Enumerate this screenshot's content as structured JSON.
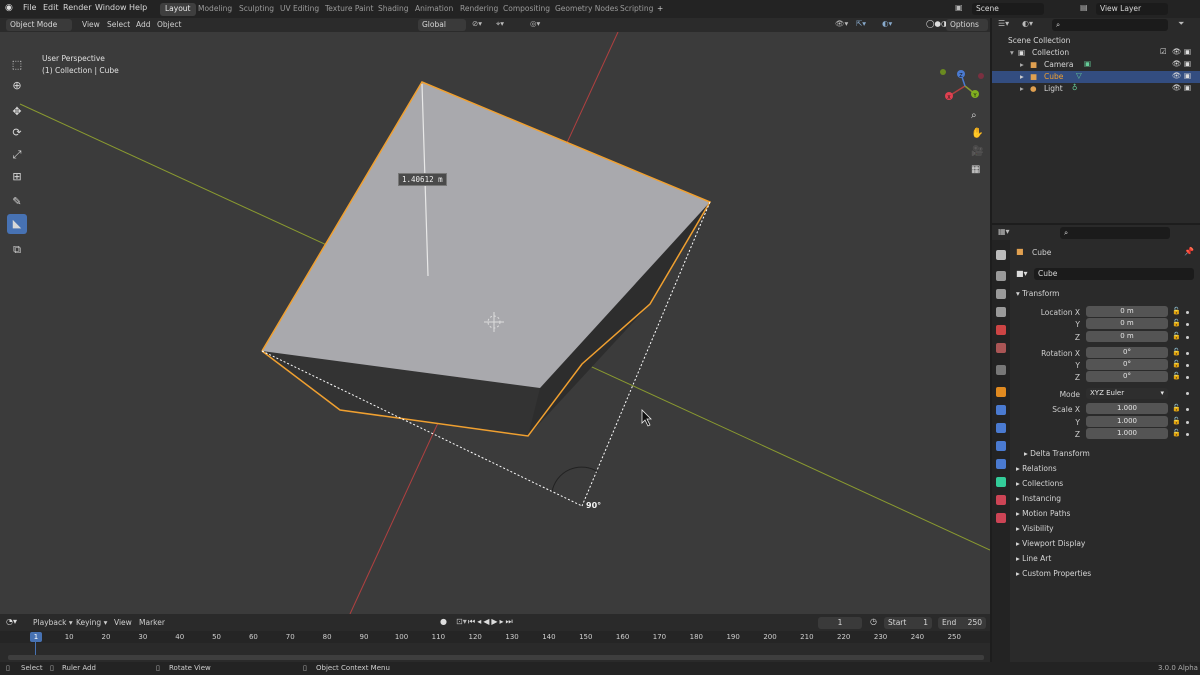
{
  "topbar": {
    "menus": [
      "File",
      "Edit",
      "Render",
      "Window",
      "Help"
    ],
    "workspaces": [
      "Layout",
      "Modeling",
      "Sculpting",
      "UV Editing",
      "Texture Paint",
      "Shading",
      "Animation",
      "Rendering",
      "Compositing",
      "Geometry Nodes",
      "Scripting"
    ],
    "active_workspace": "Layout",
    "add_tab": "+",
    "scene": "Scene",
    "view_layer": "View Layer"
  },
  "viewport_header": {
    "mode": "Object Mode",
    "menus": [
      "View",
      "Select",
      "Add",
      "Object"
    ],
    "orientation": "Global",
    "options": "Options"
  },
  "viewport": {
    "perspective": "User Perspective",
    "collection_info": "(1) Collection | Cube",
    "measure_length": "1.40612 m",
    "measure_angle": "90°",
    "gizmo_axes": [
      "X",
      "Y",
      "Z"
    ]
  },
  "outliner": {
    "root": "Scene Collection",
    "collection": "Collection",
    "items": [
      "Camera",
      "Cube",
      "Light"
    ]
  },
  "properties": {
    "object_name": "Cube",
    "data_name": "Cube",
    "transform_title": "Transform",
    "location": {
      "label_x": "Location X",
      "label_y": "Y",
      "label_z": "Z",
      "x": "0 m",
      "y": "0 m",
      "z": "0 m"
    },
    "rotation": {
      "label_x": "Rotation X",
      "label_y": "Y",
      "label_z": "Z",
      "x": "0°",
      "y": "0°",
      "z": "0°"
    },
    "mode_label": "Mode",
    "mode_value": "XYZ Euler",
    "scale": {
      "label_x": "Scale X",
      "label_y": "Y",
      "label_z": "Z",
      "x": "1.000",
      "y": "1.000",
      "z": "1.000"
    },
    "delta_transform": "Delta Transform",
    "panels": [
      "Relations",
      "Collections",
      "Instancing",
      "Motion Paths",
      "Visibility",
      "Viewport Display",
      "Line Art",
      "Custom Properties"
    ]
  },
  "timeline": {
    "menus": [
      "Playback",
      "Keying",
      "View",
      "Marker"
    ],
    "current_frame": "1",
    "start_label": "Start",
    "start": "1",
    "end_label": "End",
    "end": "250",
    "ticks": [
      "1",
      "10",
      "20",
      "30",
      "40",
      "50",
      "60",
      "70",
      "80",
      "90",
      "100",
      "110",
      "120",
      "130",
      "140",
      "150",
      "160",
      "170",
      "180",
      "190",
      "200",
      "210",
      "220",
      "230",
      "240",
      "250"
    ]
  },
  "statusbar": {
    "select": "Select",
    "ruler_add": "Ruler Add",
    "rotate_view": "Rotate View",
    "context_menu": "Object Context Menu",
    "version": "3.0.0 Alpha"
  },
  "colors": {
    "selection_outline": "#f0a030",
    "x_axis": "#b04040",
    "y_axis": "#8a9a30",
    "active_blue": "#4772b3"
  }
}
